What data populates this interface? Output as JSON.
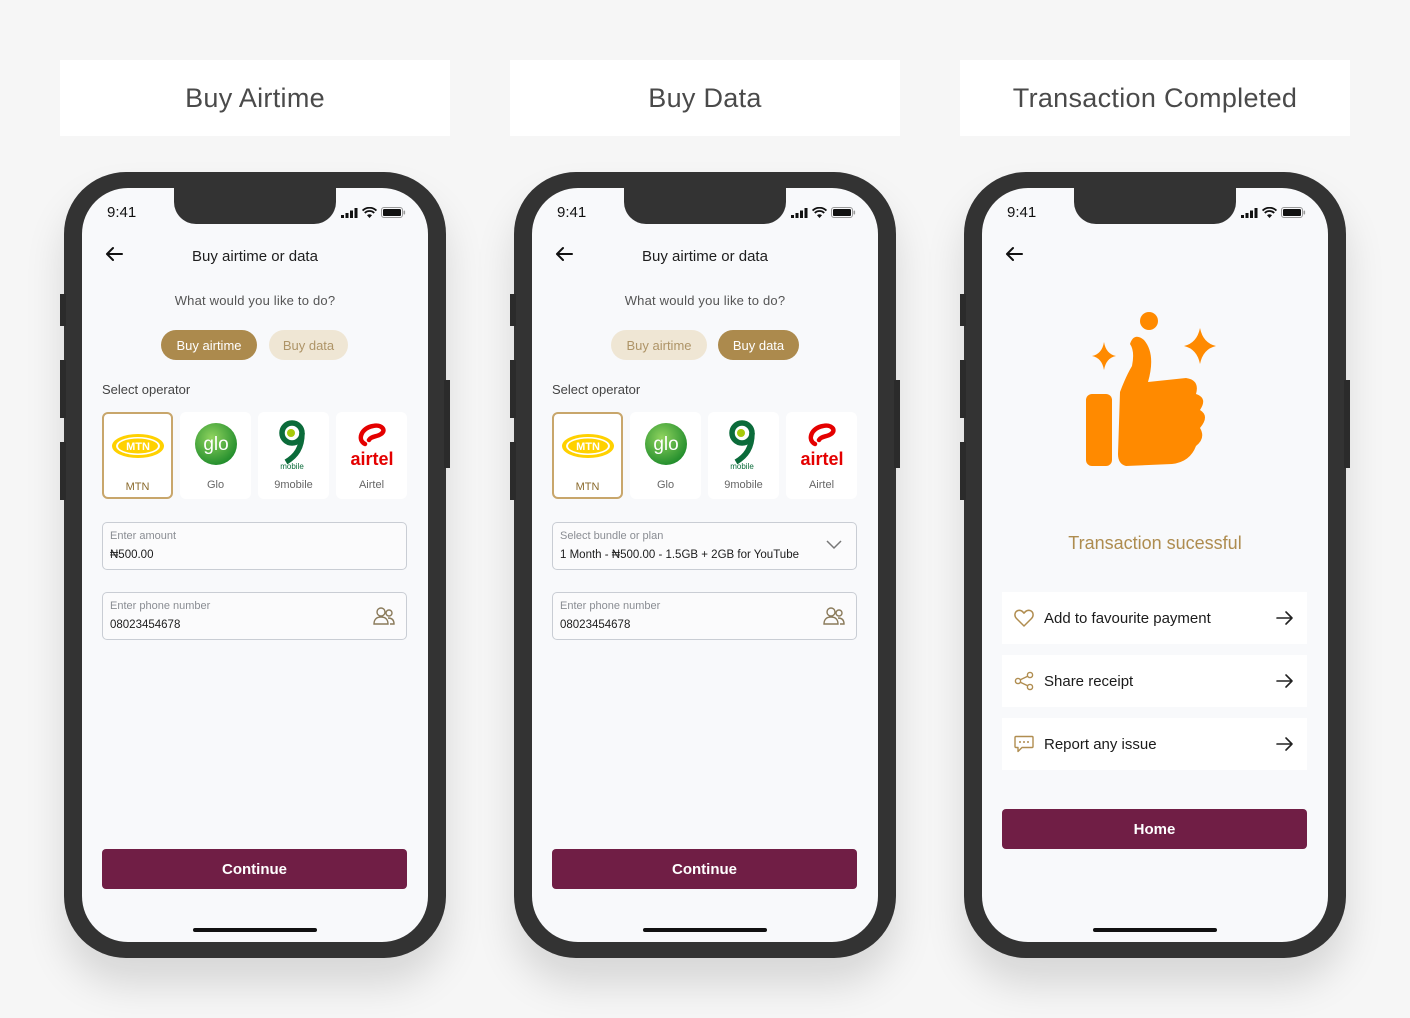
{
  "titles": [
    "Buy Airtime",
    "Buy Data",
    "Transaction Completed"
  ],
  "status_time": "9:41",
  "colors": {
    "accent_gold": "#ac8a4d",
    "pill_light": "#efe6d4",
    "primary_maroon": "#701e45",
    "success_orange": "#ff8a00"
  },
  "screen1": {
    "header": "Buy airtime or data",
    "question": "What would you like to do?",
    "tabs": [
      "Buy airtime",
      "Buy data"
    ],
    "active_tab": "Buy airtime",
    "select_operator_label": "Select operator",
    "operators": [
      "MTN",
      "Glo",
      "9mobile",
      "Airtel"
    ],
    "selected_operator": "MTN",
    "amount": {
      "label": "Enter amount",
      "value": "₦500.00"
    },
    "phone": {
      "label": "Enter phone number",
      "value": "08023454678"
    },
    "continue": "Continue"
  },
  "screen2": {
    "header": "Buy airtime or data",
    "question": "What would you like to do?",
    "tabs": [
      "Buy airtime",
      "Buy data"
    ],
    "active_tab": "Buy data",
    "select_operator_label": "Select operator",
    "operators": [
      "MTN",
      "Glo",
      "9mobile",
      "Airtel"
    ],
    "selected_operator": "MTN",
    "bundle": {
      "label": "Select bundle or plan",
      "value": "1 Month - ₦500.00 - 1.5GB + 2GB for YouTube"
    },
    "phone": {
      "label": "Enter phone number",
      "value": "08023454678"
    },
    "continue": "Continue"
  },
  "screen3": {
    "message": "Transaction sucessful",
    "actions": [
      {
        "label": "Add to favourite payment",
        "icon": "heart-icon"
      },
      {
        "label": "Share receipt",
        "icon": "share-icon"
      },
      {
        "label": "Report any issue",
        "icon": "chat-icon"
      }
    ],
    "home": "Home"
  },
  "logos": {
    "mtn": "MTN",
    "glo": "glo",
    "nine_mobile": "mobile",
    "airtel": "airtel"
  }
}
